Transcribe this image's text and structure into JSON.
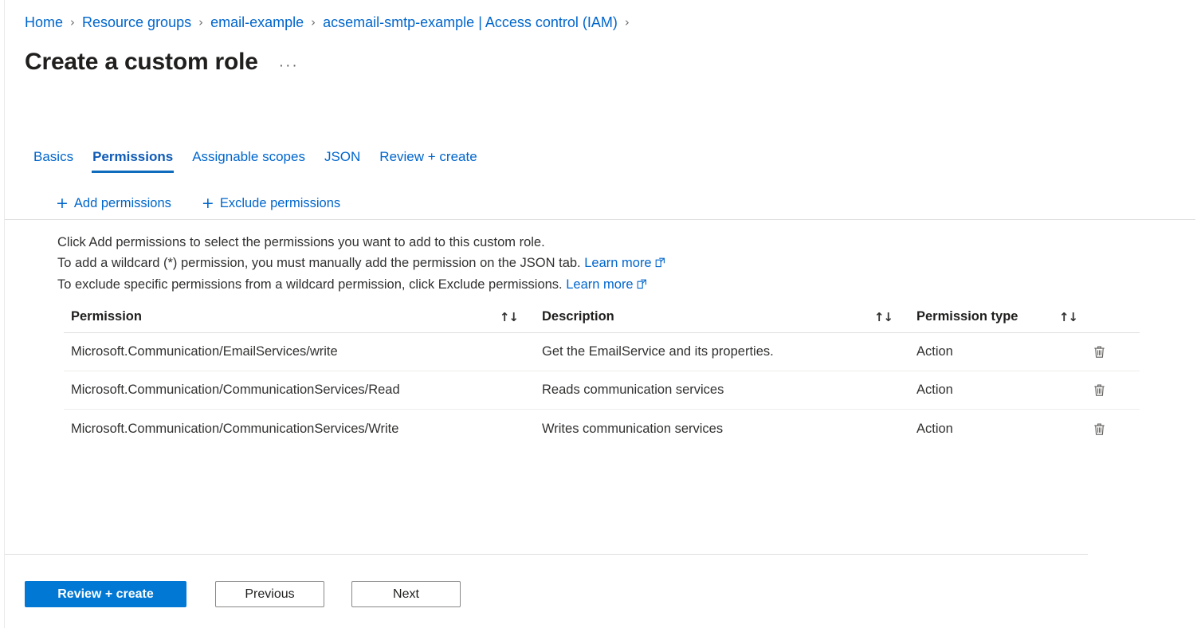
{
  "breadcrumb": {
    "separator": "›",
    "items": [
      {
        "label": "Home"
      },
      {
        "label": "Resource groups"
      },
      {
        "label": "email-example"
      },
      {
        "label": "acsemail-smtp-example | Access control (IAM)"
      }
    ]
  },
  "header": {
    "title": "Create a custom role",
    "ellipsis": "···"
  },
  "tabs": [
    {
      "label": "Basics",
      "active": false
    },
    {
      "label": "Permissions",
      "active": true
    },
    {
      "label": "Assignable scopes",
      "active": false
    },
    {
      "label": "JSON",
      "active": false
    },
    {
      "label": "Review + create",
      "active": false
    }
  ],
  "commandbar": {
    "plus": "+",
    "add_permissions_label": "Add permissions",
    "exclude_permissions_label": "Exclude permissions"
  },
  "description": {
    "line1": "Click Add permissions to select the permissions you want to add to this custom role.",
    "line2_text": "To add a wildcard (*) permission, you must manually add the permission on the JSON tab.",
    "line2_link": "Learn more",
    "line3_text": "To exclude specific permissions from a wildcard permission, click Exclude permissions.",
    "line3_link": "Learn more"
  },
  "table": {
    "sort_icon": "↑↓",
    "columns": {
      "permission": "Permission",
      "description": "Description",
      "permission_type": "Permission type"
    },
    "rows": [
      {
        "permission": "Microsoft.Communication/EmailServices/write",
        "description": "Get the EmailService and its properties.",
        "permission_type": "Action"
      },
      {
        "permission": "Microsoft.Communication/CommunicationServices/Read",
        "description": "Reads communication services",
        "permission_type": "Action"
      },
      {
        "permission": "Microsoft.Communication/CommunicationServices/Write",
        "description": "Writes communication services",
        "permission_type": "Action"
      }
    ]
  },
  "footer": {
    "review_create_label": "Review + create",
    "previous_label": "Previous",
    "next_label": "Next"
  },
  "colors": {
    "link": "#0066cc",
    "accent": "#0078d4",
    "tab_active": "#0f6cbd",
    "text": "#323130",
    "border": "#e1dfdd"
  }
}
